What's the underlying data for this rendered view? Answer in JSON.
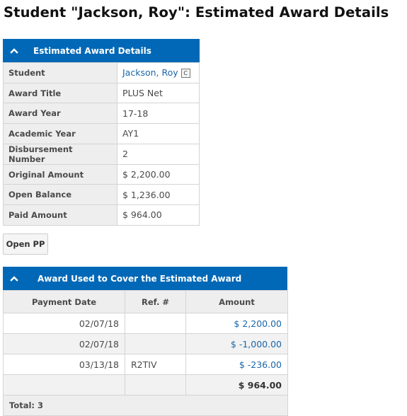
{
  "page": {
    "title": "Student \"Jackson, Roy\": Estimated Award Details"
  },
  "details_panel": {
    "header": "Estimated Award Details",
    "rows": [
      {
        "label": "Student",
        "value": "Jackson, Roy"
      },
      {
        "label": "Award Title",
        "value": "PLUS Net"
      },
      {
        "label": "Award Year",
        "value": "17-18"
      },
      {
        "label": "Academic Year",
        "value": "AY1"
      },
      {
        "label": "Disbursement Number",
        "value": "2"
      },
      {
        "label": "Original Amount",
        "value": "$ 2,200.00"
      },
      {
        "label": "Open Balance",
        "value": "$ 1,236.00"
      },
      {
        "label": "Paid Amount",
        "value": "$ 964.00"
      }
    ],
    "student_icon_glyph": "C"
  },
  "buttons": {
    "open_pp": "Open PP"
  },
  "award_panel": {
    "header": "Award Used to Cover the Estimated Award",
    "columns": [
      "Payment Date",
      "Ref. #",
      "Amount"
    ],
    "rows": [
      {
        "date": "02/07/18",
        "ref": "",
        "amount": "$ 2,200.00"
      },
      {
        "date": "02/07/18",
        "ref": "",
        "amount": "$ -1,000.00"
      },
      {
        "date": "03/13/18",
        "ref": "R2TIV",
        "amount": "$ -236.00"
      }
    ],
    "sum": "$ 964.00",
    "total_label": "Total: 3"
  },
  "colors": {
    "header_bg": "#0068b6",
    "link": "#1a66a8"
  }
}
